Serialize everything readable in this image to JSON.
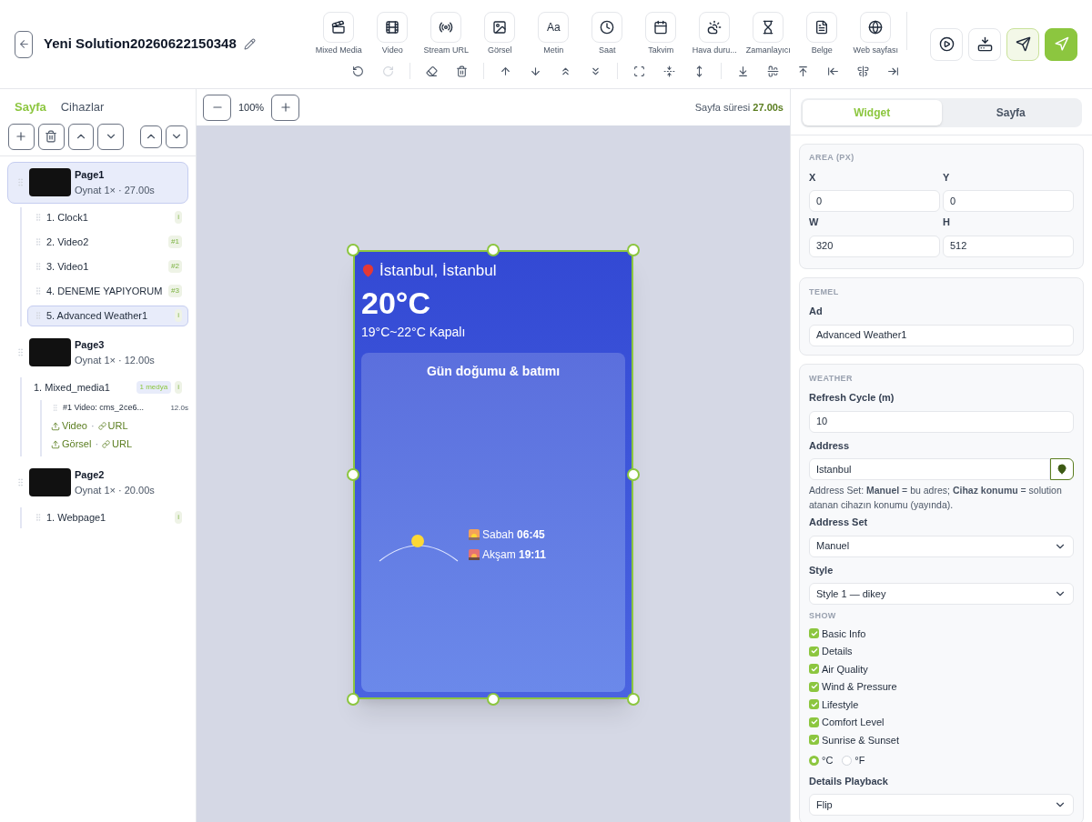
{
  "header": {
    "title": "Yeni Solution20260622150348",
    "widgets": [
      {
        "kind": "mixed",
        "label": "Mixed Media"
      },
      {
        "kind": "video",
        "label": "Video"
      },
      {
        "kind": "stream",
        "label": "Stream URL"
      },
      {
        "kind": "image",
        "label": "Görsel"
      },
      {
        "kind": "text",
        "label": "Metin",
        "glyph": "Aa"
      },
      {
        "kind": "clock",
        "label": "Saat"
      },
      {
        "kind": "calendar",
        "label": "Takvim"
      },
      {
        "kind": "weather",
        "label": "Hava duru..."
      },
      {
        "kind": "timer",
        "label": "Zamanlayıcı"
      },
      {
        "kind": "document",
        "label": "Belge"
      },
      {
        "kind": "web",
        "label": "Web sayfası"
      }
    ],
    "tools": [
      {
        "kind": "undo",
        "disabled": false
      },
      {
        "kind": "redo",
        "disabled": true
      },
      {
        "kind": "sep"
      },
      {
        "kind": "eraser",
        "disabled": false
      },
      {
        "kind": "trash",
        "disabled": false
      },
      {
        "kind": "sep"
      },
      {
        "kind": "up",
        "disabled": false
      },
      {
        "kind": "down",
        "disabled": false
      },
      {
        "kind": "top",
        "disabled": false
      },
      {
        "kind": "bottom",
        "disabled": false
      },
      {
        "kind": "sep"
      },
      {
        "kind": "fit",
        "disabled": false
      },
      {
        "kind": "vcenter",
        "disabled": false
      },
      {
        "kind": "vstretch",
        "disabled": false
      },
      {
        "kind": "sep"
      },
      {
        "kind": "alignbottom",
        "disabled": false
      },
      {
        "kind": "alignmiddle",
        "disabled": false
      },
      {
        "kind": "aligntop",
        "disabled": false
      },
      {
        "kind": "alignleft",
        "disabled": false
      },
      {
        "kind": "aligncenter",
        "disabled": false
      },
      {
        "kind": "alignright",
        "disabled": false
      }
    ],
    "actions": [
      {
        "kind": "play"
      },
      {
        "kind": "save"
      },
      {
        "kind": "send"
      },
      {
        "kind": "publish"
      }
    ]
  },
  "left": {
    "tabs": [
      {
        "label": "Sayfa",
        "selected": true
      },
      {
        "label": "Cihazlar",
        "selected": false
      }
    ],
    "pages": [
      {
        "title": "Page1",
        "subtitle": "Oynat 1× · 27.00s",
        "selected": true,
        "children": [
          {
            "label": "1. Clock1",
            "badge": "i",
            "selected": false
          },
          {
            "label": "2. Video2",
            "badge": "#1",
            "selected": false
          },
          {
            "label": "3. Video1",
            "badge": "#2",
            "selected": false
          },
          {
            "label": "4. DENEME YAPIYORUM",
            "badge": "#3",
            "selected": false
          },
          {
            "label": "5. Advanced Weather1",
            "badge": "i",
            "selected": true
          }
        ]
      },
      {
        "title": "Page3",
        "subtitle": "Oynat 1× · 12.00s",
        "selected": false,
        "children": [
          {
            "label": "1. Mixed_media1",
            "tag": "1 medya",
            "badge": "i",
            "selected": false,
            "media": [
              {
                "label": "#1 Video: cms_2ce6...",
                "duration": "12.0s"
              }
            ],
            "adders": [
              {
                "upload": "Video",
                "separator": "·",
                "link": "URL"
              },
              {
                "upload": "Görsel",
                "separator": "·",
                "link": "URL"
              }
            ]
          }
        ]
      },
      {
        "title": "Page2",
        "subtitle": "Oynat 1× · 20.00s",
        "selected": false,
        "children": [
          {
            "label": "1. Webpage1",
            "badge": "i",
            "selected": false
          }
        ]
      }
    ]
  },
  "canvas": {
    "zoom": "100%",
    "duration_label": "Sayfa süresi",
    "duration": "27.00s",
    "widget": {
      "location": "İstanbul, İstanbul",
      "temperature": "20°C",
      "range": "19°C~22°C Kapalı",
      "card_title": "Gün doğumu & batımı",
      "sunrise": "Sabah **06:45**",
      "sunset": "Akşam **19:11**"
    }
  },
  "right": {
    "tabs": [
      {
        "label": "Widget",
        "selected": true
      },
      {
        "label": "Sayfa",
        "selected": false
      }
    ],
    "area": {
      "title": "AREA (PX)",
      "fields": [
        {
          "label": "X",
          "value": "0"
        },
        {
          "label": "Y",
          "value": "0"
        },
        {
          "label": "W",
          "value": "320"
        },
        {
          "label": "H",
          "value": "512"
        }
      ]
    },
    "basic": {
      "title": "TEMEL",
      "label": "Ad",
      "value": "Advanced Weather1"
    },
    "weather": {
      "title": "WEATHER",
      "refresh_label": "Refresh Cycle (m)",
      "refresh": "10",
      "address_label": "Address",
      "address": "Istanbul",
      "hint": "Address Set: **Manuel** = bu adres; **Cihaz konumu** = solution atanan cihazın konumu (yayında).",
      "address_set_label": "Address Set",
      "address_set": "Manuel",
      "style_label": "Style",
      "style": "Style 1 — dikey",
      "show_title": "SHOW",
      "show": [
        {
          "label": "Basic Info",
          "checked": true
        },
        {
          "label": "Details",
          "checked": true
        },
        {
          "label": "Air Quality",
          "checked": true
        },
        {
          "label": "Wind & Pressure",
          "checked": true
        },
        {
          "label": "Lifestyle",
          "checked": true
        },
        {
          "label": "Comfort Level",
          "checked": true
        },
        {
          "label": "Sunrise & Sunset",
          "checked": true
        }
      ],
      "units": [
        {
          "label": "°C",
          "selected": true
        },
        {
          "label": "°F",
          "selected": false
        }
      ],
      "playback_label": "Details Playback",
      "playback": "Flip"
    }
  }
}
